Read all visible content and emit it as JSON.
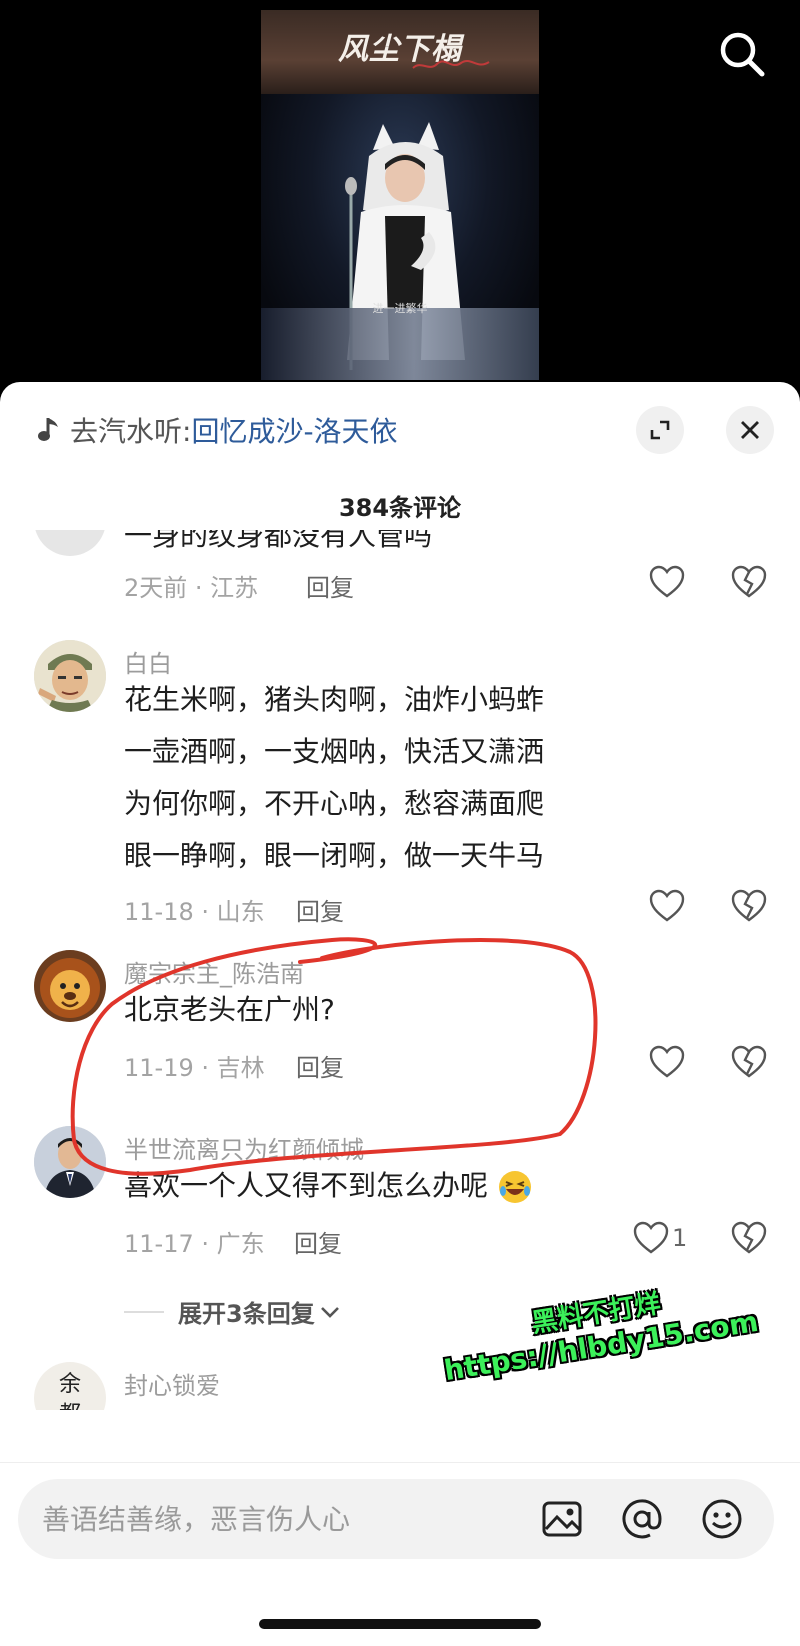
{
  "video": {
    "title": "风尘下榻",
    "subtitle": "进一进繁华"
  },
  "panel": {
    "music_prefix": "去汽水听:",
    "music_song": "回忆成沙-洛天依",
    "comment_count_label": "384条评论"
  },
  "comments": [
    {
      "name": "",
      "lines": [
        "一身的纹身都没有人管吗"
      ],
      "time": "2天前 · 江苏",
      "reply_label": "回复",
      "likes": ""
    },
    {
      "name": "白白",
      "lines": [
        "花生米啊，猪头肉啊，油炸小蚂蚱",
        "一壶酒啊，一支烟呐，快活又潇洒",
        "为何你啊，不开心呐，愁容满面爬",
        "眼一睁啊，眼一闭啊，做一天牛马"
      ],
      "time": "11-18 · 山东",
      "reply_label": "回复",
      "likes": ""
    },
    {
      "name": "魔宗宗主_陈浩南",
      "lines": [
        "北京老头在广州?"
      ],
      "time": "11-19 · 吉林",
      "reply_label": "回复",
      "likes": ""
    },
    {
      "name": "半世流离只为红颜倾城",
      "lines": [
        "喜欢一个人又得不到怎么办呢"
      ],
      "time": "11-17 · 广东",
      "reply_label": "回复",
      "likes": "1",
      "expand_replies_label": "展开3条回复"
    },
    {
      "name": "封心锁爱",
      "avatar_text": "余都",
      "lines": [],
      "time": "",
      "reply_label": "",
      "likes": ""
    }
  ],
  "watermark": {
    "line1": "黑料不打烊",
    "line2": "https://hlbdy15.com"
  },
  "input": {
    "placeholder": "善语结善缘，恶言伤人心"
  },
  "icons": [
    "search-icon",
    "music-note-icon",
    "expand-icon",
    "close-icon",
    "heart-icon",
    "broken-heart-icon",
    "chevron-down-icon",
    "image-icon",
    "at-icon",
    "emoji-icon"
  ],
  "colors": {
    "song_link": "#2e5b9a",
    "annotation_circle": "#e0352b",
    "watermark": "#3cf05a"
  }
}
